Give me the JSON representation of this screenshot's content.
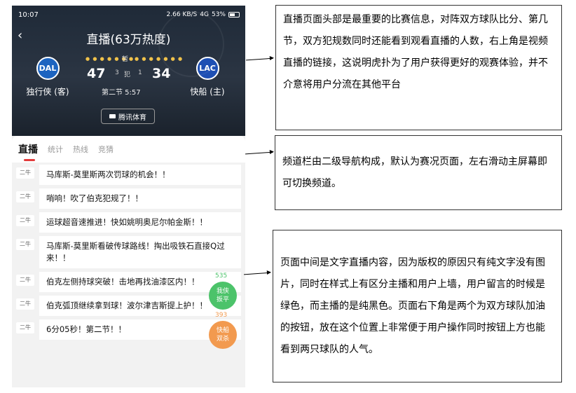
{
  "status": {
    "time": "10:07",
    "net": "2.66 KB/S",
    "signal": "4G",
    "battery": "53%"
  },
  "header": {
    "title": "直播(63万热度)",
    "pause_label": "暂",
    "home_team": {
      "abbr": "DAL",
      "name": "独行侠 (客)",
      "score": "47",
      "fouls": "3"
    },
    "away_team": {
      "abbr": "LAC",
      "name": "快船 (主)",
      "score": "34",
      "fouls": "1"
    },
    "foul_label": "犯",
    "period": "第二节 5:57",
    "video_link": "腾讯体育"
  },
  "tabs": [
    {
      "label": "直播",
      "active": true
    },
    {
      "label": "统计",
      "active": false
    },
    {
      "label": "热线",
      "active": false
    },
    {
      "label": "竞猜",
      "active": false
    }
  ],
  "feed": [
    {
      "anchor": "二牛",
      "text": "马库斯-莫里斯两次罚球的机会！！"
    },
    {
      "anchor": "二牛",
      "text": "哨响！吹了伯克犯规了！！"
    },
    {
      "anchor": "二牛",
      "text": "运球超音速推进！快如姚明奥尼尔帕金斯！！"
    },
    {
      "anchor": "二牛",
      "text": "马库斯-莫里斯看破传球路线！掏出吸铁石直接Q过来！！"
    },
    {
      "anchor": "二牛",
      "text": "伯克左侧持球突破！击地再找油漆区内！！"
    },
    {
      "anchor": "二牛",
      "text": "伯克弧顶继续拿到球！波尔津吉斯提上护！！"
    },
    {
      "anchor": "二牛",
      "text": "6分05秒！第二节！！"
    }
  ],
  "cheer": {
    "left": {
      "count": "535",
      "label": "我侠\n扳平",
      "color": "#4cc36a"
    },
    "right": {
      "count": "393",
      "label": "快船\n双杀",
      "color": "#f29a4f"
    }
  },
  "notes": {
    "header_note": "直播页面头部是最重要的比赛信息，对阵双方球队比分、第几节，双方犯规数同时还能看到观看直播的人数，右上角是视频直播的链接，这说明虎扑为了用户获得更好的观赛体验，并不介意将用户分流在其他平台",
    "tabs_note": "频道栏由二级导航构成，默认为赛况页面，左右滑动主屏幕即可切换频道。",
    "feed_note": "页面中间是文字直播内容，因为版权的原因只有纯文字没有图片，同时在样式上有区分主播和用户上墙，用户留言的时候是绿色，而主播的是纯黑色。页面右下角是两个为双方球队加油的按钮，放在这个位置上非常便于用户操作同时按钮上方也能看到两只球队的人气。"
  }
}
